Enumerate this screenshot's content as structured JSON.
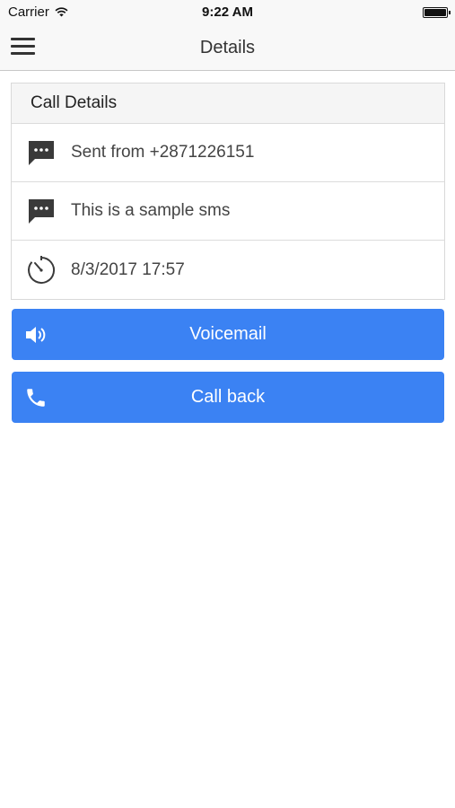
{
  "status_bar": {
    "carrier": "Carrier",
    "time": "9:22 AM"
  },
  "nav": {
    "title": "Details",
    "menu_icon": "hamburger-menu-icon"
  },
  "card": {
    "header": "Call Details",
    "rows": [
      {
        "icon": "message-icon",
        "text": "Sent from +2871226151"
      },
      {
        "icon": "message-icon",
        "text": "This is a sample sms"
      },
      {
        "icon": "timer-icon",
        "text": "8/3/2017 17:57"
      }
    ]
  },
  "buttons": {
    "voicemail": {
      "label": "Voicemail",
      "icon": "speaker-icon"
    },
    "call_back": {
      "label": "Call back",
      "icon": "phone-icon"
    }
  },
  "colors": {
    "accent": "#3b82f3",
    "nav_bg": "#f8f8f8",
    "text": "#333333"
  }
}
